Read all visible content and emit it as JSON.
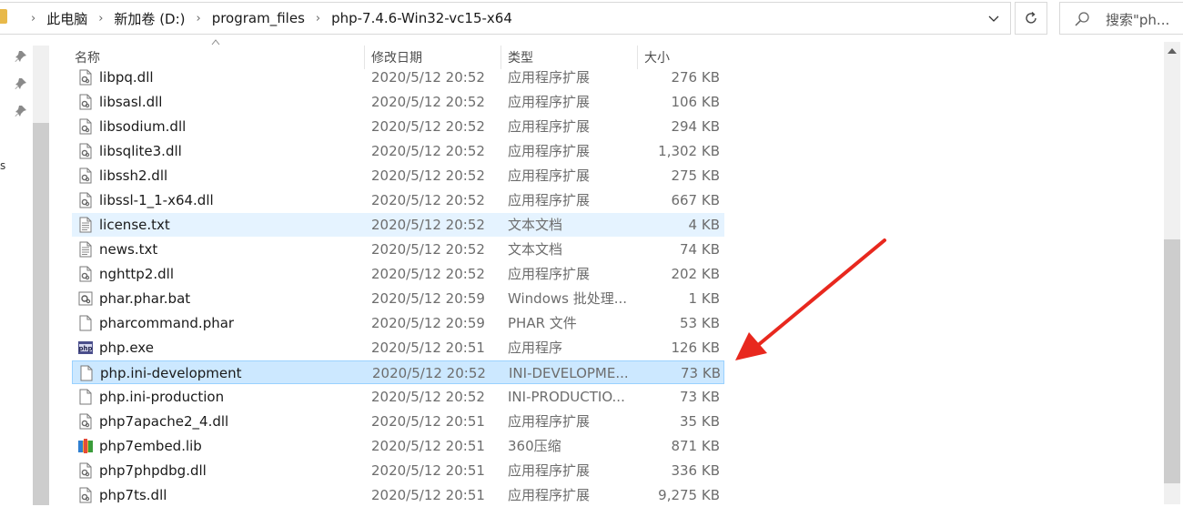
{
  "address_bar": {
    "crumbs": [
      "此电脑",
      "新加卷 (D:)",
      "program_files",
      "php-7.4.6-Win32-vc15-x64"
    ],
    "search_placeholder": "搜索\"ph..."
  },
  "nav_fragment": "s",
  "columns": {
    "name": "名称",
    "date": "修改日期",
    "type": "类型",
    "size": "大小"
  },
  "files": [
    {
      "name": "libpq.dll",
      "date": "2020/5/12 20:52",
      "type": "应用程序扩展",
      "size": "276 KB",
      "icon": "dll-icon"
    },
    {
      "name": "libsasl.dll",
      "date": "2020/5/12 20:52",
      "type": "应用程序扩展",
      "size": "106 KB",
      "icon": "dll-icon"
    },
    {
      "name": "libsodium.dll",
      "date": "2020/5/12 20:52",
      "type": "应用程序扩展",
      "size": "294 KB",
      "icon": "dll-icon"
    },
    {
      "name": "libsqlite3.dll",
      "date": "2020/5/12 20:52",
      "type": "应用程序扩展",
      "size": "1,302 KB",
      "icon": "dll-icon"
    },
    {
      "name": "libssh2.dll",
      "date": "2020/5/12 20:52",
      "type": "应用程序扩展",
      "size": "275 KB",
      "icon": "dll-icon"
    },
    {
      "name": "libssl-1_1-x64.dll",
      "date": "2020/5/12 20:52",
      "type": "应用程序扩展",
      "size": "667 KB",
      "icon": "dll-icon"
    },
    {
      "name": "license.txt",
      "date": "2020/5/12 20:52",
      "type": "文本文档",
      "size": "4 KB",
      "icon": "text-file-icon",
      "state": "hover"
    },
    {
      "name": "news.txt",
      "date": "2020/5/12 20:52",
      "type": "文本文档",
      "size": "74 KB",
      "icon": "text-file-icon"
    },
    {
      "name": "nghttp2.dll",
      "date": "2020/5/12 20:52",
      "type": "应用程序扩展",
      "size": "202 KB",
      "icon": "dll-icon"
    },
    {
      "name": "phar.phar.bat",
      "date": "2020/5/12 20:59",
      "type": "Windows 批处理...",
      "size": "1 KB",
      "icon": "batch-file-icon"
    },
    {
      "name": "pharcommand.phar",
      "date": "2020/5/12 20:59",
      "type": "PHAR 文件",
      "size": "53 KB",
      "icon": "blank-file-icon"
    },
    {
      "name": "php.exe",
      "date": "2020/5/12 20:51",
      "type": "应用程序",
      "size": "126 KB",
      "icon": "php-exe-icon"
    },
    {
      "name": "php.ini-development",
      "date": "2020/5/12 20:52",
      "type": "INI-DEVELOPME...",
      "size": "73 KB",
      "icon": "blank-file-icon",
      "state": "selected"
    },
    {
      "name": "php.ini-production",
      "date": "2020/5/12 20:52",
      "type": "INI-PRODUCTIO...",
      "size": "73 KB",
      "icon": "blank-file-icon"
    },
    {
      "name": "php7apache2_4.dll",
      "date": "2020/5/12 20:51",
      "type": "应用程序扩展",
      "size": "35 KB",
      "icon": "dll-icon"
    },
    {
      "name": "php7embed.lib",
      "date": "2020/5/12 20:51",
      "type": "360压缩",
      "size": "871 KB",
      "icon": "archive-icon"
    },
    {
      "name": "php7phpdbg.dll",
      "date": "2020/5/12 20:51",
      "type": "应用程序扩展",
      "size": "336 KB",
      "icon": "dll-icon"
    },
    {
      "name": "php7ts.dll",
      "date": "2020/5/12 20:51",
      "type": "应用程序扩展",
      "size": "9,275 KB",
      "icon": "dll-icon"
    }
  ],
  "colors": {
    "selected_bg": "#cce8ff",
    "selected_border": "#99d1ff",
    "hover_bg": "#e5f3ff",
    "annotation_arrow": "#e8281e"
  }
}
